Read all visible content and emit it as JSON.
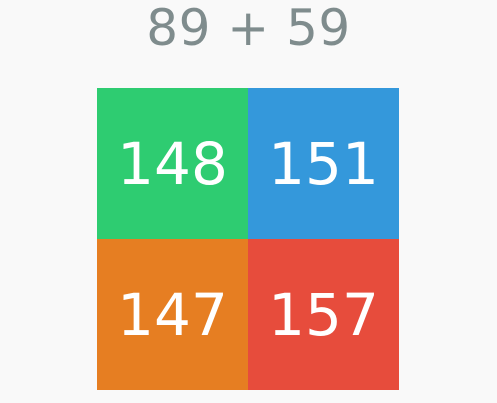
{
  "question": "89 + 59",
  "options": [
    {
      "label": "148",
      "color": "#2ecc71"
    },
    {
      "label": "151",
      "color": "#3498db"
    },
    {
      "label": "147",
      "color": "#e67e22"
    },
    {
      "label": "157",
      "color": "#e74c3c"
    }
  ],
  "colors": {
    "background": "#f9f9f9",
    "question_text": "#7f8c8d",
    "tile_text": "#ffffff"
  }
}
